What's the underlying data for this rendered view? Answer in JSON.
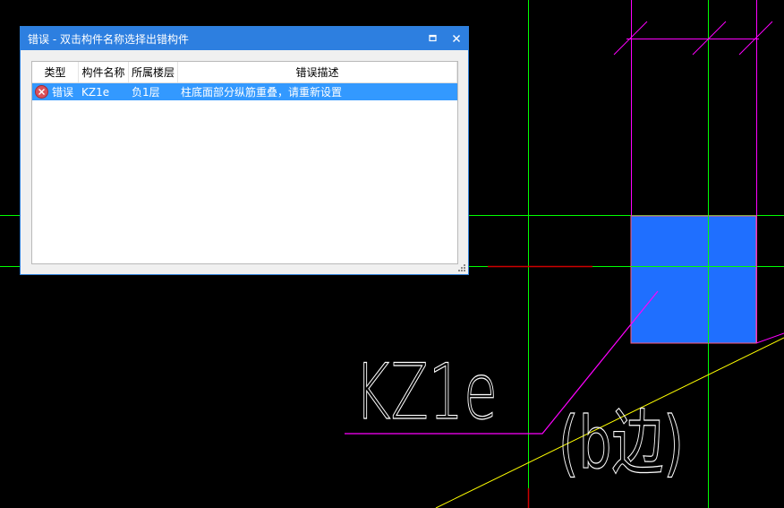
{
  "dialog": {
    "title": "错误 - 双击构件名称选择出错构件",
    "maximize_icon": "maximize-icon",
    "close_icon": "close-icon",
    "columns": [
      "类型",
      "构件名称",
      "所属楼层",
      "错误描述"
    ],
    "rows": [
      {
        "type_icon": "error-icon",
        "type": "错误",
        "name": "KZ1e",
        "floor": "负1层",
        "description": "柱底面部分纵筋重叠，请重新设置"
      }
    ]
  },
  "cad": {
    "component_label": "KZ1e",
    "side_label": "(b边)",
    "colors": {
      "background": "#000000",
      "grid_green": "#00ff00",
      "magenta": "#ff00ff",
      "column_fill": "#1f6fff",
      "yellow": "#ffff00",
      "red": "#cc0000",
      "label": "#ffffff"
    }
  }
}
